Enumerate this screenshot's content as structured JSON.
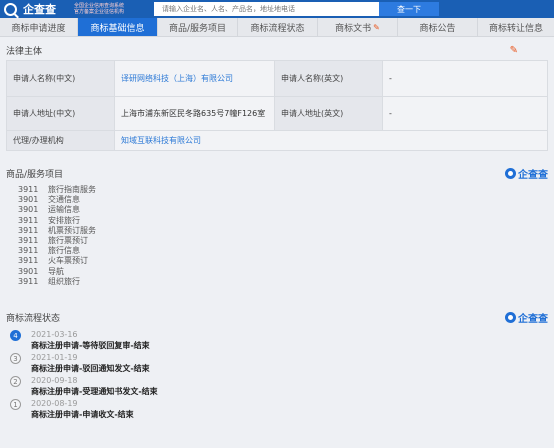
{
  "header": {
    "logo_text": "企查查",
    "slogan_line1": "全国企业信用查询系统",
    "slogan_line2": "官方备案企业征信机构",
    "search_placeholder": "请输入企业名、人名、产品名，地址地电话",
    "search_button": "查一下"
  },
  "tabs": [
    {
      "label": "商标申请进度"
    },
    {
      "label": "商标基础信息"
    },
    {
      "label": "商品/服务项目"
    },
    {
      "label": "商标流程状态"
    },
    {
      "label": "商标文书"
    },
    {
      "label": "商标公告"
    },
    {
      "label": "商标转让信息"
    }
  ],
  "legal": {
    "title": "法律主体",
    "rows": [
      {
        "l1": "申请人名称(中文)",
        "v1": "译研网络科技（上海）有限公司",
        "l2": "申请人名称(英文)",
        "v2": "-"
      },
      {
        "l1": "申请人地址(中文)",
        "v1": "上海市浦东新区民冬路635号7幢F126室",
        "l2": "申请人地址(英文)",
        "v2": "-"
      },
      {
        "l1": "代理/办理机构",
        "v1": "知域互联科技有限公司"
      }
    ]
  },
  "goods": {
    "title": "商品/服务项目",
    "brand": "企查查",
    "items": [
      {
        "code": "3911",
        "name": "旅行指南服务"
      },
      {
        "code": "3901",
        "name": "交通信息"
      },
      {
        "code": "3901",
        "name": "运输信息"
      },
      {
        "code": "3911",
        "name": "安排旅行"
      },
      {
        "code": "3911",
        "name": "机票预订服务"
      },
      {
        "code": "3911",
        "name": "旅行票预订"
      },
      {
        "code": "3911",
        "name": "旅行信息"
      },
      {
        "code": "3911",
        "name": "火车票预订"
      },
      {
        "code": "3901",
        "name": "导航"
      },
      {
        "code": "3911",
        "name": "组织旅行"
      }
    ]
  },
  "flow": {
    "title": "商标流程状态",
    "brand": "企查查",
    "items": [
      {
        "n": "4",
        "date": "2021-03-16",
        "text": "商标注册申请-等待驳回复审-结束"
      },
      {
        "n": "3",
        "date": "2021-01-19",
        "text": "商标注册申请-驳回通知发文-结束"
      },
      {
        "n": "2",
        "date": "2020-09-18",
        "text": "商标注册申请-受理通知书发文-结束"
      },
      {
        "n": "1",
        "date": "2020-08-19",
        "text": "商标注册申请-申请收文-结束"
      }
    ]
  },
  "colors": {
    "accent": "#1f6fd6",
    "orange": "#e9541b"
  },
  "icons": {
    "edit": "edit-icon"
  }
}
